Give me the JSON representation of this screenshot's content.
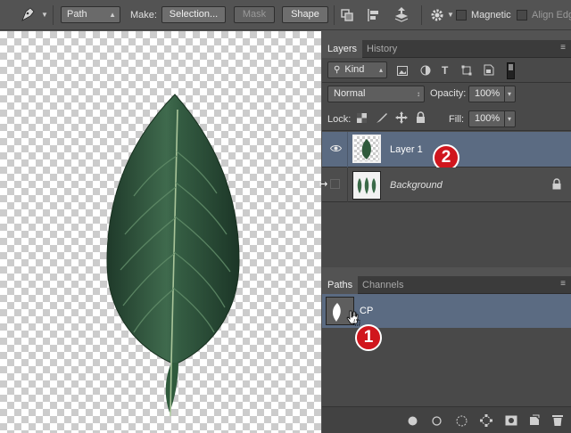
{
  "options_bar": {
    "tool_icon": "pen-tool-icon",
    "mode_value": "Path",
    "make_label": "Make:",
    "selection_button": "Selection...",
    "mask_button": "Mask",
    "shape_button": "Shape",
    "magnetic_label": "Magnetic",
    "align_edges_label": "Align Edg"
  },
  "layers_panel": {
    "tabs": [
      "Layers",
      "History"
    ],
    "active_tab": "Layers",
    "filter_value": "Kind",
    "blend_mode": "Normal",
    "opacity_label": "Opacity:",
    "opacity_value": "100%",
    "lock_label": "Lock:",
    "fill_label": "Fill:",
    "fill_value": "100%",
    "layers": [
      {
        "name": "Layer 1",
        "selected": true,
        "visible": true
      },
      {
        "name": "Background",
        "selected": false,
        "visible": false,
        "locked": true
      }
    ],
    "callout": "2"
  },
  "paths_panel": {
    "tabs": [
      "Paths",
      "Channels"
    ],
    "active_tab": "Paths",
    "paths": [
      {
        "name": "CP",
        "selected": true
      }
    ],
    "callout": "1",
    "footer_icons": [
      "fill-path-icon",
      "stroke-path-icon",
      "load-selection-icon",
      "make-work-path-icon",
      "add-mask-icon",
      "new-path-icon",
      "trash-icon"
    ]
  },
  "colors": {
    "selected_row": "#5b6b82",
    "panel_bg": "#494949",
    "callout_red": "#d0161d"
  }
}
